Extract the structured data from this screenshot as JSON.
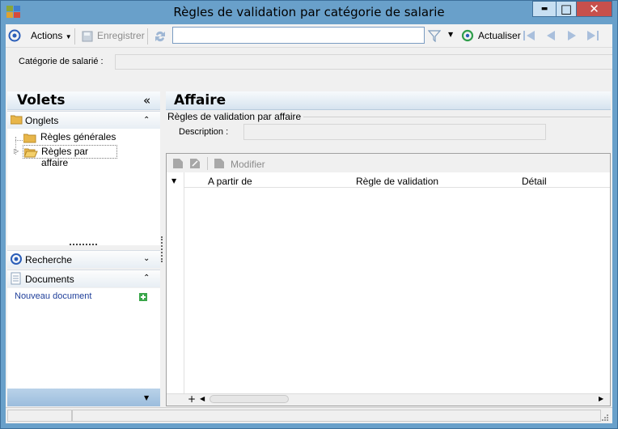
{
  "window": {
    "title": "Règles de validation par catégorie de salarie",
    "minimize": "▬",
    "maximize": "□",
    "close": "✕"
  },
  "toolbar": {
    "actions_label": "Actions",
    "save_label": "Enregistrer",
    "search_value": "",
    "refresh_label": "Actualiser"
  },
  "filters": {
    "category_label": "Catégorie de salarié :",
    "category_value": ""
  },
  "left_panel": {
    "title": "Volets",
    "collapse_glyph": "«",
    "sections": {
      "onglets": {
        "label": "Onglets",
        "items": [
          "Règles générales",
          "Règles par affaire"
        ]
      },
      "recherche": {
        "label": "Recherche"
      },
      "documents": {
        "label": "Documents",
        "new_doc_label": "Nouveau document"
      }
    }
  },
  "main": {
    "title": "Affaire",
    "group_label": "Règles de validation par affaire",
    "description_label": "Description :",
    "description_value": "",
    "grid": {
      "modify_label": "Modifier",
      "columns": [
        "A partir de",
        "Règle de validation",
        "Détail"
      ],
      "footer_add": "+"
    }
  },
  "colors": {
    "window_frame": "#69a0ca",
    "close_button": "#c7504c",
    "link": "#1f3f9a"
  }
}
